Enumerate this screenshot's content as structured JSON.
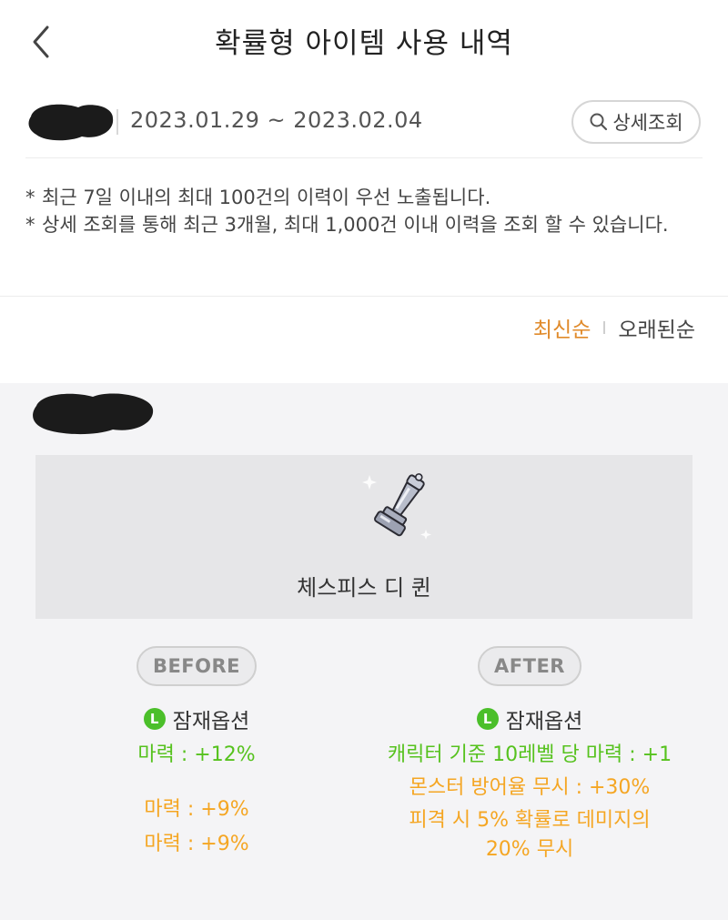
{
  "header": {
    "title": "확률형 아이템 사용 내역",
    "back_icon": "chevron-left-icon"
  },
  "filter": {
    "date_range": "2023.01.29 ~ 2023.02.04",
    "detail_button_label": "상세조회",
    "detail_icon": "search-icon"
  },
  "notes": [
    {
      "star": "*",
      "text": "최근 7일 이내의 최대 100건의 이력이 우선 노출됩니다."
    },
    {
      "star": "*",
      "text": "상세 조회를 통해 최근 3개월, 최대 1,000건 이내 이력을 조회 할 수 있습니다."
    }
  ],
  "sort": {
    "newest": "최신순",
    "oldest": "오래된순",
    "active_color": "#e08a2a"
  },
  "item": {
    "name": "체스피스 디 퀸",
    "icon": "chess-queen-icon"
  },
  "before": {
    "label": "BEFORE",
    "badge": "L",
    "option_title": "잠재옵션",
    "lines": [
      "마력 : +12%",
      "마력 : +9%",
      "마력 : +9%"
    ]
  },
  "after": {
    "label": "AFTER",
    "badge": "L",
    "option_title": "잠재옵션",
    "lines": [
      "캐릭터 기준 10레벨 당 마력 : +1",
      "몬스터 방어율 무시 : +30%",
      "피격 시 5% 확률로 데미지의 20% 무시"
    ]
  },
  "colors": {
    "legendary_green": "#56c21e",
    "unique_orange": "#f5a623",
    "badge_green": "#4bbf2a"
  }
}
